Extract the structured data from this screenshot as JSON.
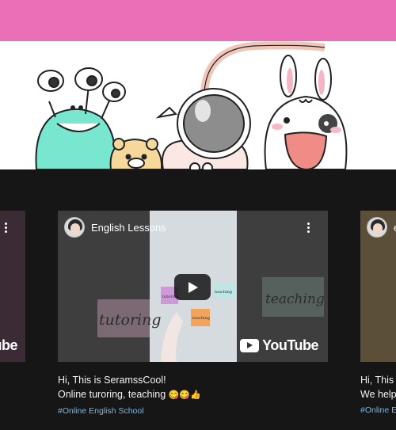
{
  "header": {
    "color": "#ea6fb6"
  },
  "hero": {
    "illustration": "cartoon-characters"
  },
  "cards": [
    {
      "channel": "",
      "youtube_label": "ube"
    },
    {
      "channel": "English Lessons",
      "youtube_label": "YouTube",
      "thumb_words": [
        "tutoring",
        "teaching",
        "tutoring",
        "teaching",
        "teaching"
      ],
      "caption_line1": "Hi, This is SeramssCool!",
      "caption_line2": "Online turoring, teaching",
      "emoji": "😋😋👍",
      "hashtag": "#Online English School"
    },
    {
      "channel": "e",
      "caption_line1": "Hi, This i",
      "caption_line2": "We help",
      "hashtag": "#Online E"
    }
  ]
}
